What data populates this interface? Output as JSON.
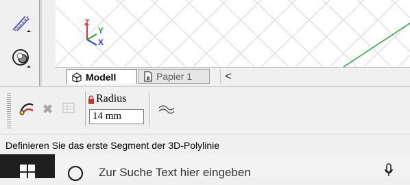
{
  "tabs": {
    "model_label": "Modell",
    "paper_label": "Papier 1",
    "scroll_left": "<"
  },
  "command_bar": {
    "radius_label": "Radius",
    "radius_value": "14 mm"
  },
  "status": {
    "prompt": "Definieren Sie das erste Segment der 3D-Polylinie"
  },
  "taskbar": {
    "search_placeholder": "Zur Suche Text hier eingeben"
  },
  "ucs_axes": {
    "z": "Z",
    "y": "Y",
    "x": "X"
  },
  "colors": {
    "axis_z": "#e0392b",
    "axis_y": "#2e9e3a",
    "axis_x": "#2b3bd6",
    "grid": "#cfd6e6",
    "taskbar_bg": "#1f1f1f"
  },
  "icons": {
    "left_tool_1": "line-draw-icon",
    "left_tool_2": "shape-tool-icon",
    "model_tab": "model-icon",
    "paper_tab": "paper-layout-icon",
    "cmd_tool_1": "polyline-tool-icon",
    "cmd_tool_2": "close-icon",
    "cmd_tool_3": "table-icon",
    "radius_lock": "lock-icon",
    "cmd_tool_4": "curve-icon",
    "windows_start": "windows-icon",
    "search": "search-icon",
    "microphone": "microphone-icon"
  }
}
